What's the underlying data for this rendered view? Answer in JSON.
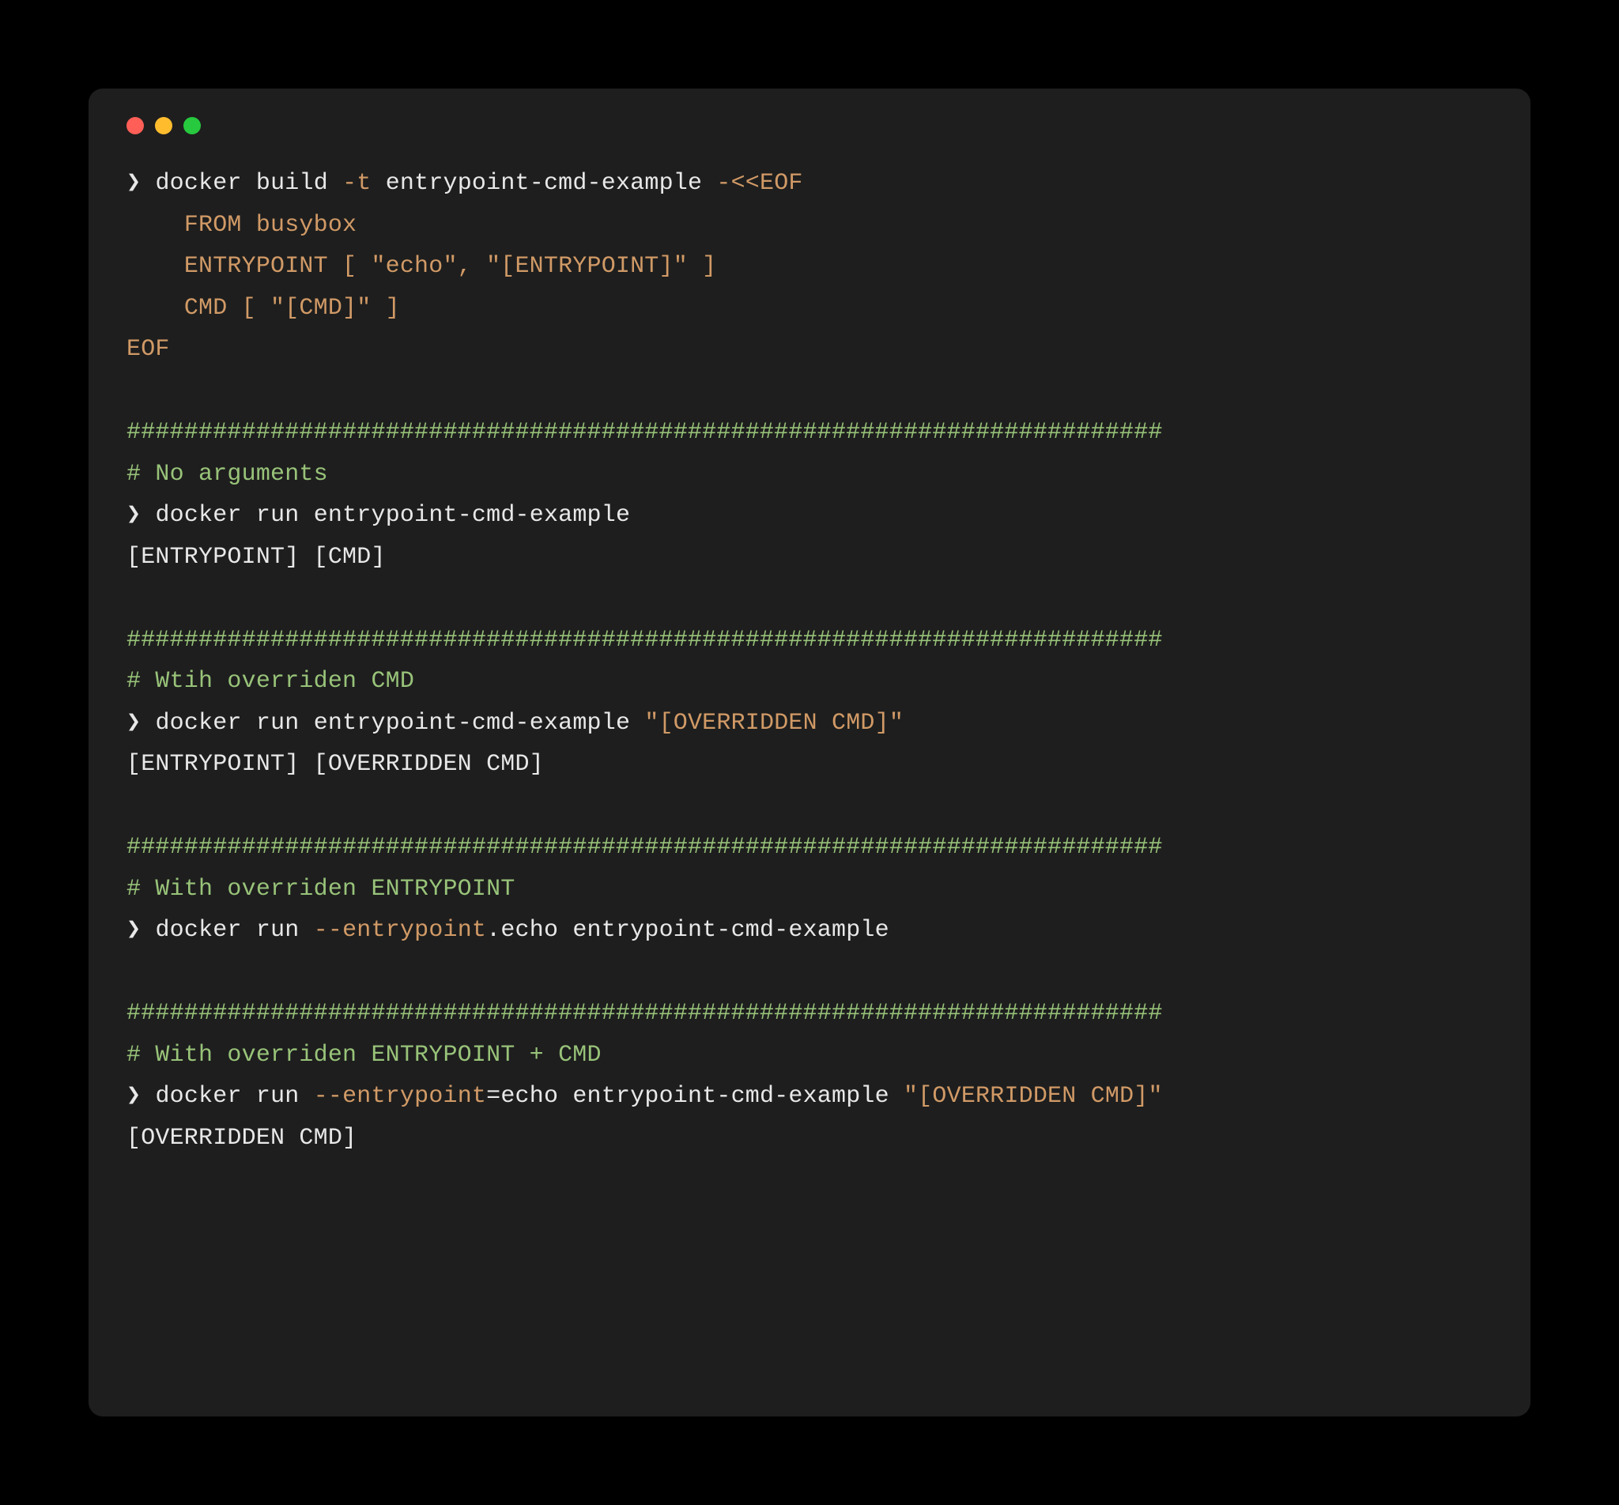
{
  "colors": {
    "page_bg": "#000000",
    "terminal_bg": "#1e1e1e",
    "text_default": "#e8e8e8",
    "text_orange": "#d19a66",
    "text_green": "#98c379",
    "traffic_red": "#ff5f56",
    "traffic_yellow": "#ffbd2e",
    "traffic_green": "#27c93f"
  },
  "prompt_glyph": "❯ ",
  "indent": "    ",
  "divider_green": "########################################################################",
  "build": {
    "cmd_tokens": {
      "docker": "docker",
      "build": "build ",
      "flag_t": "-t ",
      "image": "entrypoint-cmd-example ",
      "heredoc_open": "-<<EOF"
    },
    "heredoc_lines": {
      "from": "FROM busybox",
      "entrypoint": "ENTRYPOINT [ \"echo\", \"[ENTRYPOINT]\" ]",
      "cmd": "CMD [ \"[CMD]\" ]"
    },
    "heredoc_close": "EOF"
  },
  "sections": {
    "no_args": {
      "comment": "# No arguments",
      "docker": "docker",
      "run": "run",
      "image": "entrypoint-cmd-example",
      "output": "[ENTRYPOINT] [CMD]"
    },
    "override_cmd": {
      "comment": "# Wtih overriden CMD",
      "docker": "docker",
      "run": "run",
      "image": "entrypoint-cmd-example",
      "arg_quoted": "\"[OVERRIDDEN CMD]\"",
      "output": "[ENTRYPOINT] [OVERRIDDEN CMD]"
    },
    "override_entrypoint": {
      "comment": "# With overriden ENTRYPOINT",
      "docker": "docker",
      "run": "run",
      "flag": "--entrypoint",
      "after_flag": ".echo",
      "image": "entrypoint-cmd-example"
    },
    "override_both": {
      "comment": "# With overriden ENTRYPOINT + CMD",
      "docker": "docker",
      "run": "run",
      "flag": "--entrypoint",
      "after_flag": "=echo",
      "image": "entrypoint-cmd-example",
      "arg_quoted": "\"[OVERRIDDEN CMD]\"",
      "output": "[OVERRIDDEN CMD]"
    }
  }
}
